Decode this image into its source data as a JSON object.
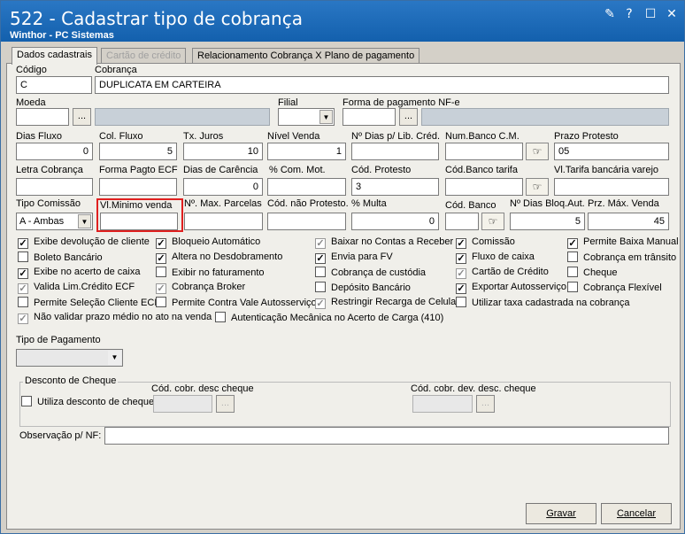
{
  "window": {
    "title": "522 - Cadastrar tipo de cobrança",
    "subtitle": "Winthor - PC Sistemas"
  },
  "tabs": [
    "Dados cadastrais",
    "Cartão de crédito",
    "Relacionamento Cobrança X Plano de pagamento"
  ],
  "fields": {
    "codigo": {
      "label": "Código",
      "value": "C"
    },
    "cobranca": {
      "label": "Cobrança",
      "value": "DUPLICATA EM CARTEIRA"
    },
    "moeda": {
      "label": "Moeda",
      "value": ""
    },
    "filial": {
      "label": "Filial",
      "value": ""
    },
    "forma_pagamento_nfe": {
      "label": "Forma de pagamento NF-e",
      "value": ""
    },
    "dias_fluxo": {
      "label": "Dias Fluxo",
      "value": "0"
    },
    "col_fluxo": {
      "label": "Col. Fluxo",
      "value": "5"
    },
    "tx_juros": {
      "label": "Tx. Juros",
      "value": "10"
    },
    "nivel_venda": {
      "label": "Nível Venda",
      "value": "1"
    },
    "dias_lib_cred": {
      "label": "Nº Dias p/ Lib. Créd.",
      "value": ""
    },
    "num_banco_cm": {
      "label": "Num.Banco C.M.",
      "value": ""
    },
    "prazo_protesto": {
      "label": "Prazo Protesto",
      "value": "05"
    },
    "letra_cobranca": {
      "label": "Letra Cobrança",
      "value": ""
    },
    "forma_pagto_ecf": {
      "label": "Forma Pagto ECF",
      "value": ""
    },
    "dias_carencia": {
      "label": "Dias de Carência",
      "value": "0"
    },
    "com_mot": {
      "label": "% Com. Mot.",
      "value": ""
    },
    "cod_protesto": {
      "label": "Cód. Protesto",
      "value": "3"
    },
    "cod_banco_tarifa": {
      "label": "Cód.Banco tarifa",
      "value": ""
    },
    "vl_tarifa": {
      "label": "Vl.Tarifa bancária varejo",
      "value": ""
    },
    "tipo_comissao": {
      "label": "Tipo Comissão",
      "value": "A - Ambas"
    },
    "vl_minimo_venda": {
      "label": "Vl.Minimo venda",
      "value": ""
    },
    "max_parcelas": {
      "label": "Nº. Max. Parcelas",
      "value": ""
    },
    "cod_nao_protesto": {
      "label": "Cód. não Protesto.",
      "value": ""
    },
    "multa": {
      "label": "% Multa",
      "value": "0"
    },
    "cod_banco": {
      "label": "Cód. Banco",
      "value": ""
    },
    "dias_bloq_aut": {
      "label": "Nº Dias Bloq.Aut.",
      "value": "5"
    },
    "prz_max_venda": {
      "label": "Prz. Máx. Venda",
      "value": "45"
    },
    "tipo_pagamento": {
      "label": "Tipo de Pagamento",
      "value": ""
    },
    "observacao": {
      "label": "Observação p/ NF:",
      "value": ""
    }
  },
  "checkboxes": [
    {
      "label": "Exibe devolução de cliente",
      "checked": true,
      "gray": false
    },
    {
      "label": "Boleto Bancário",
      "checked": false,
      "gray": false
    },
    {
      "label": "Exibe no acerto de caixa",
      "checked": true,
      "gray": false
    },
    {
      "label": "Valida Lim.Crédito ECF",
      "checked": true,
      "gray": true
    },
    {
      "label": "Permite Seleção Cliente ECF",
      "checked": false,
      "gray": false
    },
    {
      "label": "Não validar prazo médio no ato na venda",
      "checked": true,
      "gray": true
    },
    {
      "label": "Bloqueio Automático",
      "checked": true,
      "gray": false
    },
    {
      "label": "Altera no Desdobramento",
      "checked": true,
      "gray": false
    },
    {
      "label": "Exibir no faturamento",
      "checked": false,
      "gray": false
    },
    {
      "label": "Cobrança Broker",
      "checked": true,
      "gray": true
    },
    {
      "label": "Permite Contra Vale Autosserviço",
      "checked": false,
      "gray": false
    },
    {
      "label": "Autenticação Mecânica no Acerto de Carga (410)",
      "checked": false,
      "gray": false
    },
    {
      "label": "Baixar no Contas a Receber",
      "checked": true,
      "gray": true
    },
    {
      "label": "Envia para FV",
      "checked": true,
      "gray": false
    },
    {
      "label": "Cobrança de custódia",
      "checked": false,
      "gray": false
    },
    {
      "label": "Depósito Bancário",
      "checked": false,
      "gray": false
    },
    {
      "label": "Restringir Recarga de Celular",
      "checked": true,
      "gray": true
    },
    {
      "label": "Comissão",
      "checked": true,
      "gray": false
    },
    {
      "label": "Fluxo de caixa",
      "checked": true,
      "gray": false
    },
    {
      "label": "Cartão de Crédito",
      "checked": true,
      "gray": true
    },
    {
      "label": "Exportar Autosserviço",
      "checked": true,
      "gray": false
    },
    {
      "label": "Utilizar taxa cadastrada na cobrança",
      "checked": false,
      "gray": false
    },
    {
      "label": "Permite Baixa Manual",
      "checked": true,
      "gray": false
    },
    {
      "label": "Cobrança em trânsito",
      "checked": false,
      "gray": false
    },
    {
      "label": "Cheque",
      "checked": false,
      "gray": false
    },
    {
      "label": "Cobrança Flexível",
      "checked": false,
      "gray": false
    }
  ],
  "desconto": {
    "title": "Desconto de Cheque",
    "utiliza": "Utiliza desconto de cheque",
    "cod_desc": "Cód. cobr. desc cheque",
    "cod_dev": "Cód. cobr. dev. desc. cheque"
  },
  "buttons": {
    "ellipsis": "...",
    "gravar": "Gravar",
    "cancelar": "Cancelar"
  }
}
